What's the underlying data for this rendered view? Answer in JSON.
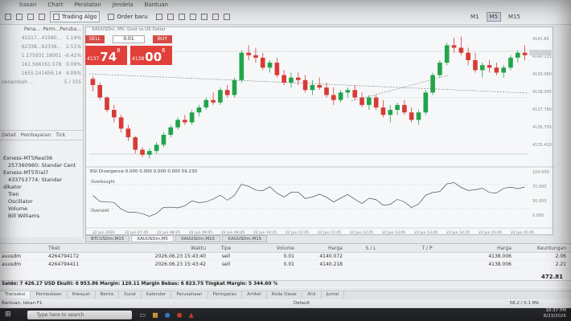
{
  "menu": [
    "",
    "tiasan",
    "Chart",
    "Peralatan",
    "Jendela",
    "Bantuan"
  ],
  "toolbar": {
    "algo_label": "Trading Algo",
    "order_label": "Order baru",
    "timeframes": [
      "M1",
      "M5",
      "M15"
    ],
    "active_tf": "M5"
  },
  "watchlist": {
    "headers": [
      "Pena...",
      "Perm...",
      "Peruba..."
    ],
    "rows": [
      [
        "41517...",
        "41580...",
        "1.19%"
      ],
      [
        "62338...",
        "62338...",
        "2.51%"
      ],
      [
        "1.17593",
        "1.18001",
        "-0.41%"
      ],
      [
        "161.566",
        "161.578",
        "0.09%"
      ],
      [
        "1655.14",
        "1656.14",
        "4.09%"
      ]
    ],
    "footer_left": "nenambah ...",
    "footer_right": "5 / 355"
  },
  "panel_tabs": [
    "Detail",
    "Pembayaran",
    "Tick"
  ],
  "navigator": {
    "items": [
      {
        "label": "Exness-MT5Real36",
        "indent": false
      },
      {
        "label": "257360960: Standar Cent",
        "indent": true
      },
      {
        "label": "Exness-MT5Trial7",
        "indent": false
      },
      {
        "label": "433753774: Standar",
        "indent": true
      },
      {
        "label": "dikator",
        "indent": false
      },
      {
        "label": "Tren",
        "indent": true
      },
      {
        "label": "Oscillator",
        "indent": true
      },
      {
        "label": "Volume",
        "indent": true
      },
      {
        "label": "Bill Williams",
        "indent": true
      }
    ]
  },
  "chart": {
    "title": "XAUUSDm, M5: Gold vs US Dollar",
    "sell_label": "SELL",
    "buy_label": "BUY",
    "lot": "0.01",
    "sell_small": "4137",
    "sell_big": "74",
    "sell_sup": "8",
    "buy_small": "4138",
    "buy_big": "00",
    "buy_sup": "6",
    "indicator_label": "RSI Divergence 0.000 0.000 0.000 0.000 59.230",
    "overbought": "Overbought",
    "oversold": "Oversold",
    "y_labels": [
      "4141.85",
      "4140.125",
      "4139.060",
      "4138.005",
      "4137.760",
      "4136.755",
      "4135.410"
    ],
    "osc_labels": [
      "100.000",
      "70.000",
      "30.000",
      "0.000"
    ],
    "x_labels": [
      "22 Jun 2026",
      "22 Jun 07:45",
      "22 Jun 08:25",
      "22 Jun 09:05",
      "22 Jun 09:45",
      "22 Jun 10:25",
      "22 Jun 11:05",
      "22 Jun 11:45",
      "22 Jun 12:25",
      "22 Jun 13:05",
      "22 Jun 13:45",
      "22 Jun 14:25",
      "22 Jun 15:05",
      "22 Jun 15:45"
    ],
    "tabs": [
      "BTCUSDm,M15",
      "XAUUSDm,M5",
      "XAUUSDm,M15",
      "XAUUSDm,M15"
    ],
    "active_tab": 1,
    "accent": "#d33a32",
    "bull": "#23a44b",
    "bear": "#d63b35"
  },
  "chart_data": {
    "type": "candlestick",
    "candles": [
      [
        65,
        67,
        55,
        60
      ],
      [
        60,
        62,
        48,
        50
      ],
      [
        50,
        51,
        38,
        40
      ],
      [
        40,
        44,
        30,
        34
      ],
      [
        34,
        36,
        22,
        25
      ],
      [
        25,
        28,
        15,
        18
      ],
      [
        18,
        19,
        5,
        8
      ],
      [
        8,
        10,
        2,
        4
      ],
      [
        4,
        9,
        1,
        7
      ],
      [
        7,
        14,
        5,
        12
      ],
      [
        12,
        22,
        10,
        20
      ],
      [
        20,
        28,
        18,
        26
      ],
      [
        26,
        34,
        24,
        32
      ],
      [
        32,
        36,
        28,
        30
      ],
      [
        30,
        40,
        28,
        38
      ],
      [
        38,
        44,
        35,
        42
      ],
      [
        42,
        50,
        40,
        48
      ],
      [
        48,
        54,
        44,
        46
      ],
      [
        46,
        58,
        44,
        56
      ],
      [
        56,
        60,
        50,
        52
      ],
      [
        52,
        66,
        50,
        64
      ],
      [
        64,
        88,
        62,
        86
      ],
      [
        86,
        92,
        80,
        84
      ],
      [
        84,
        90,
        78,
        82
      ],
      [
        82,
        86,
        72,
        74
      ],
      [
        74,
        80,
        70,
        78
      ],
      [
        78,
        82,
        66,
        68
      ],
      [
        68,
        72,
        60,
        62
      ],
      [
        62,
        70,
        58,
        66
      ],
      [
        66,
        70,
        60,
        64
      ],
      [
        64,
        68,
        54,
        56
      ],
      [
        56,
        64,
        52,
        60
      ],
      [
        60,
        66,
        56,
        58
      ],
      [
        58,
        62,
        50,
        52
      ],
      [
        52,
        58,
        44,
        48
      ],
      [
        48,
        56,
        46,
        54
      ],
      [
        54,
        58,
        50,
        56
      ],
      [
        56,
        60,
        48,
        50
      ],
      [
        50,
        54,
        42,
        44
      ],
      [
        44,
        52,
        40,
        50
      ],
      [
        50,
        52,
        40,
        42
      ],
      [
        42,
        48,
        34,
        36
      ],
      [
        36,
        44,
        30,
        40
      ],
      [
        40,
        46,
        36,
        44
      ],
      [
        44,
        48,
        36,
        38
      ],
      [
        38,
        42,
        30,
        32
      ],
      [
        32,
        40,
        28,
        38
      ],
      [
        38,
        56,
        36,
        54
      ],
      [
        54,
        70,
        52,
        68
      ],
      [
        68,
        80,
        66,
        78
      ],
      [
        78,
        94,
        76,
        92
      ],
      [
        92,
        98,
        86,
        90
      ],
      [
        90,
        99,
        84,
        86
      ],
      [
        86,
        90,
        76,
        80
      ],
      [
        80,
        86,
        70,
        72
      ],
      [
        72,
        78,
        66,
        76
      ],
      [
        76,
        80,
        70,
        74
      ],
      [
        74,
        78,
        68,
        70
      ],
      [
        70,
        76,
        66,
        74
      ],
      [
        74,
        84,
        72,
        82
      ],
      [
        82,
        88,
        78,
        86
      ],
      [
        86,
        92,
        80,
        84
      ]
    ],
    "price_range": [
      0,
      100
    ]
  },
  "positions": {
    "headers": [
      "",
      "Tiket",
      "Waktu",
      "Tipe",
      "Volume",
      "Harga",
      "S / L",
      "T / P",
      "Harga",
      "Keuntungan"
    ],
    "rows": [
      [
        "auusdm",
        "4264794172",
        "2026.06.23 15:43:40",
        "sell",
        "0.01",
        "4140.072",
        "",
        "",
        "4138.006",
        "2.06"
      ],
      [
        "auusdm",
        "4264794411",
        "2026.06.23 15:43:42",
        "sell",
        "0.01",
        "4140.218",
        "",
        "",
        "4138.006",
        "2.21"
      ]
    ],
    "total": "472.81",
    "balance_line": "Saldo: 7 426.17 USD  Ekuiti: 6 953.86  Margin: 120.11  Margin Bebas: 6 823.75  Tingkat Margin: 5 344.60 %"
  },
  "bottom_tabs": [
    "Transaksi",
    "Pembukaan",
    "Riwayat",
    "Berita",
    "Surat",
    "Kalender",
    "Perusahaan",
    "Peringatan",
    "Artikel",
    "Koda Dasar",
    "Ahli",
    "Jurnal"
  ],
  "status": {
    "left": "Bantuan, tekan F1",
    "center": "Default",
    "right": "58.2 / 0.1 Mb"
  },
  "taskbar": {
    "search": "Type here to search",
    "time": "10:37 PM",
    "date": "6/23/2026"
  }
}
